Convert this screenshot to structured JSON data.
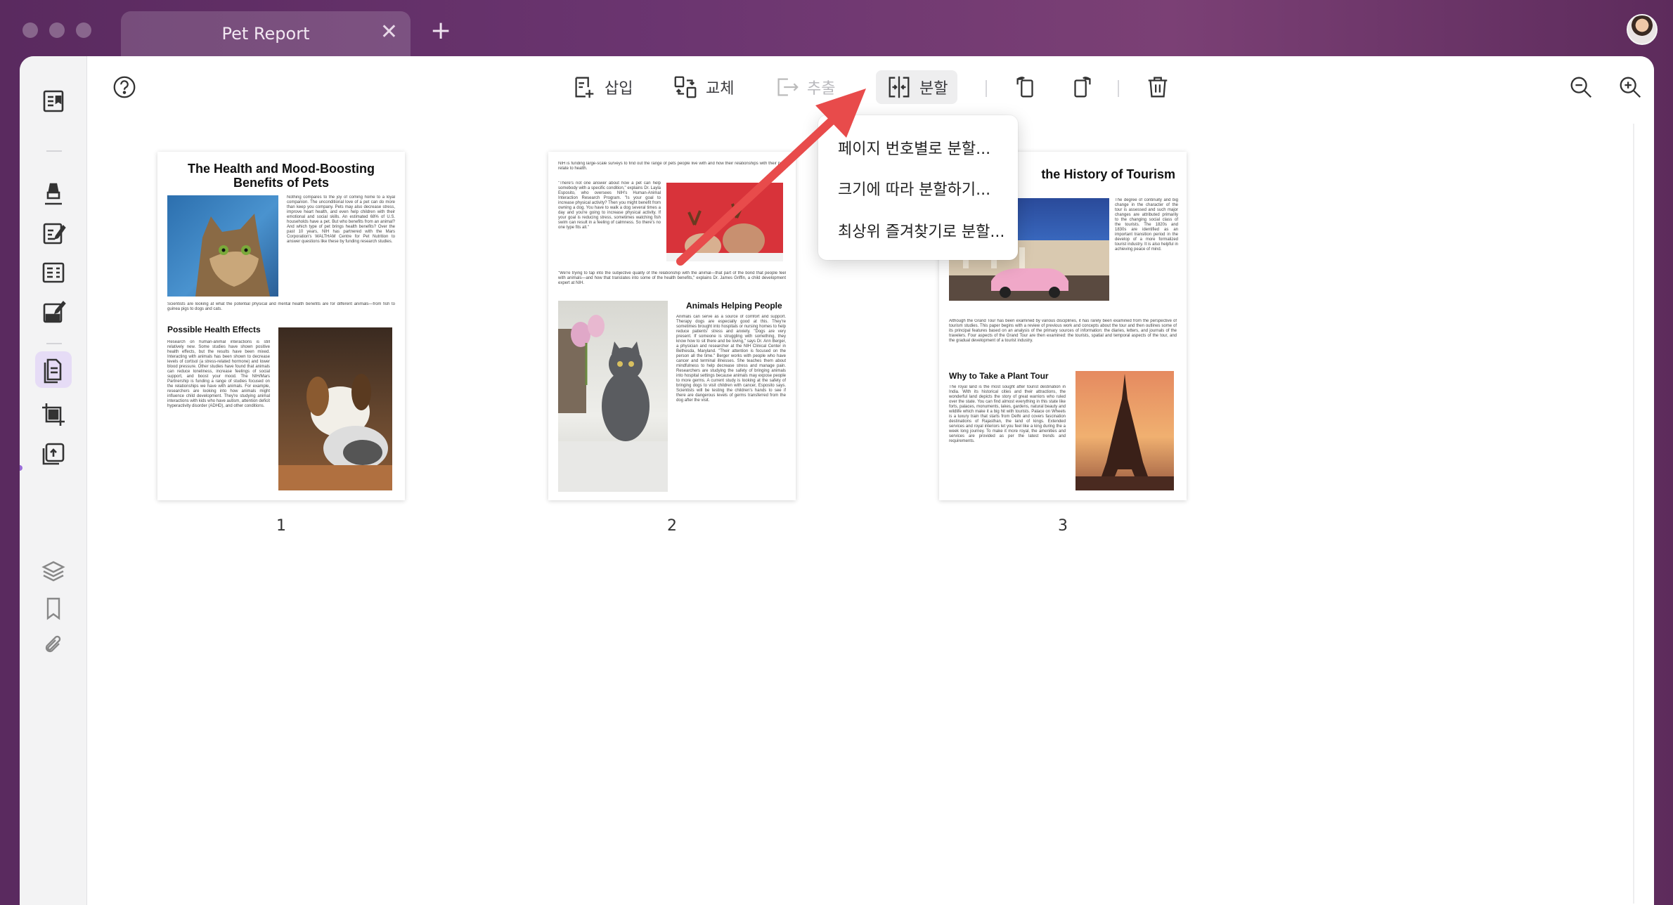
{
  "window": {
    "tab_title": "Pet Report",
    "tab_close": "✕",
    "new_tab": "+"
  },
  "toolbar": {
    "help": "?",
    "insert": "삽입",
    "replace": "교체",
    "extract": "추출",
    "split": "분할"
  },
  "split_menu": {
    "items": [
      "페이지 번호별로 분할...",
      "크기에 따라 분할하기...",
      "최상위 즐겨찾기로 분할..."
    ]
  },
  "pages": [
    {
      "number": "1",
      "title": "The Health and Mood-Boosting Benefits of Pets",
      "heading": "Possible Health Effects",
      "intro": "Nothing compares to the joy of coming home to a loyal companion. The unconditional love of a pet can do more than keep you company. Pets may also decrease stress, improve heart health, and even help children with their emotional and social skills. An estimated 68% of U.S. households have a pet. But who benefits from an animal? And which type of pet brings health benefits? Over the past 10 years, NIH has partnered with the Mars Corporation's WALTHAM Centre for Pet Nutrition to answer questions like these by funding research studies.",
      "middle": "Scientists are looking at what the potential physical and mental health benefits are for different animals—from fish to guinea pigs to dogs and cats.",
      "body": "Research on human-animal interactions is still relatively new. Some studies have shown positive health effects, but the results have been mixed. Interacting with animals has been shown to decrease levels of cortisol (a stress-related hormone) and lower blood pressure. Other studies have found that animals can reduce loneliness, increase feelings of social support, and boost your mood. The NIH/Mars Partnership is funding a range of studies focused on the relationships we have with animals. For example, researchers are looking into how animals might influence child development. They're studying animal interactions with kids who have autism, attention deficit hyperactivity disorder (ADHD), and other conditions."
    },
    {
      "number": "2",
      "heading": "Animals Helping People",
      "top": "NIH is funding large-scale surveys to find out the range of pets people live with and how their relationships with their pets relate to health.",
      "left": "\"There's not one answer about how a pet can help somebody with a specific condition,\" explains Dr. Layla Esposito, who oversees NIH's Human-Animal Interaction Research Program. \"Is your goal to increase physical activity? Then you might benefit from owning a dog. You have to walk a dog several times a day and you're going to increase physical activity. If your goal is reducing stress, sometimes watching fish swim can result in a feeling of calmness. So there's no one type fits all.\"",
      "mid": "\"We're trying to tap into the subjective quality of the relationship with the animal—that part of the bond that people feel with animals—and how that translates into some of the health benefits,\" explains Dr. James Griffin, a child development expert at NIH.",
      "right": "Animals can serve as a source of comfort and support. Therapy dogs are especially good at this. They're sometimes brought into hospitals or nursing homes to help reduce patients' stress and anxiety. \"Dogs are very present. If someone is struggling with something, they know how to sit there and be loving,\" says Dr. Ann Berger, a physician and researcher at the NIH Clinical Center in Bethesda, Maryland. \"Their attention is focused on the person all the time.\" Berger works with people who have cancer and terminal illnesses. She teaches them about mindfulness to help decrease stress and manage pain. Researchers are studying the safety of bringing animals into hospital settings because animals may expose people to more germs. A current study is looking at the safety of bringing dogs to visit children with cancer, Esposito says. Scientists will be testing the children's hands to see if there are dangerous levels of germs transferred from the dog after the visit."
    },
    {
      "number": "3",
      "title": "the History of Tourism",
      "heading": "Why to Take a Plant Tour",
      "right": "The degree of continuity and big change in the character of the tour is assessed and such major changes are attributed primarily to the changing social class of the tourists. The 1820s and 1830s are identified as an important transition period in the develop of a more formalized tourist industry. It is also helpful in achieving peace of mind.",
      "middle": "Although the Grand Tour has been examined by various disciplines, it has rarely been examined from the perspective of tourism studies. This paper begins with a review of previous work and concepts about the tour and then outlines some of its principal features based on an analysis of the primary sources of information: the diaries, letters, and journals of the travelers. Four aspects of the Grand Tour are then examined: the tourists, spatial and temporal aspects of the tour, and the gradual development of a tourist industry.",
      "body": "The royal land is the most sought after tourist destination in India. With its historical cities and their attractions, the wonderful land depicts the story of great warriors who ruled over the state. You can find almost everything in this state like forts, palaces, monuments, lakes, gardens, natural beauty and wildlife which make it a big hit with tourists. Palace on Wheels is a luxury train that starts from Delhi and covers fascination destinations of Rajasthan, the land of kings. Extended services and royal interiors let you feel like a king during the a week long journey. To make it more royal, the amenities and services are provided as per the latest trends and requirements."
    }
  ]
}
